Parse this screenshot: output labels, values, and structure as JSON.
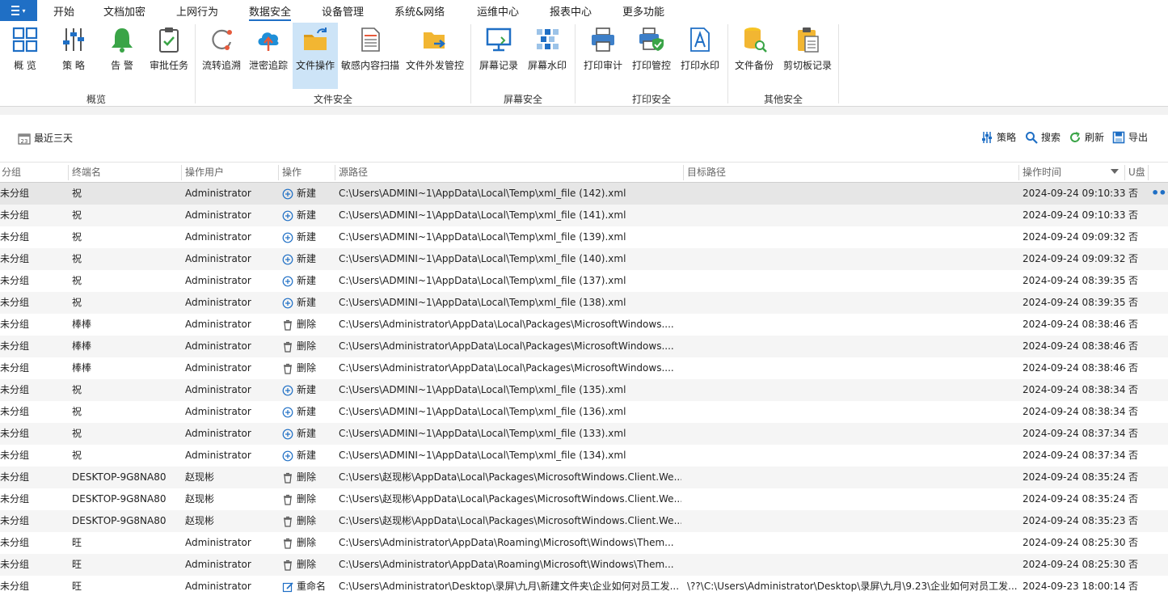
{
  "menu": {
    "items": [
      "开始",
      "文档加密",
      "上网行为",
      "数据安全",
      "设备管理",
      "系统&网络",
      "运维中心",
      "报表中心",
      "更多功能"
    ],
    "active": "数据安全"
  },
  "ribbon": {
    "buttons": [
      {
        "label": "概 览",
        "icon": "grid-icon"
      },
      {
        "label": "策 略",
        "icon": "sliders-icon"
      },
      {
        "label": "告 警",
        "icon": "bell-icon"
      },
      {
        "label": "审批任务",
        "icon": "clipboard-check-icon"
      },
      {
        "label": "流转追溯",
        "icon": "trace-icon"
      },
      {
        "label": "泄密追踪",
        "icon": "cloud-upload-icon"
      },
      {
        "label": "文件操作",
        "icon": "folder-arrow-icon",
        "active": true
      },
      {
        "label": "敏感内容扫描",
        "icon": "document-scan-icon"
      },
      {
        "label": "文件外发管控",
        "icon": "folder-send-icon"
      },
      {
        "label": "屏幕记录",
        "icon": "monitor-icon"
      },
      {
        "label": "屏幕水印",
        "icon": "watermark-icon"
      },
      {
        "label": "打印审计",
        "icon": "printer-icon"
      },
      {
        "label": "打印管控",
        "icon": "printer-shield-icon"
      },
      {
        "label": "打印水印",
        "icon": "document-a-icon"
      },
      {
        "label": "文件备份",
        "icon": "database-search-icon"
      },
      {
        "label": "剪切板记录",
        "icon": "clipboard-icon"
      }
    ],
    "groups": [
      "概览",
      "文件安全",
      "屏幕安全",
      "打印安全",
      "其他安全"
    ]
  },
  "toolbar": {
    "date_filter": "最近三天",
    "policy": "策略",
    "search": "搜索",
    "refresh": "刷新",
    "export": "导出"
  },
  "table": {
    "columns": [
      "分组",
      "终端名",
      "操作用户",
      "操作",
      "源路径",
      "目标路径",
      "操作时间",
      "U盘"
    ],
    "rows": [
      [
        "未分组",
        "祝",
        "Administrator",
        "新建",
        "C:\\Users\\ADMINI~1\\AppData\\Local\\Temp\\xml_file (142).xml",
        "",
        "2024-09-24 09:10:33",
        "否"
      ],
      [
        "未分组",
        "祝",
        "Administrator",
        "新建",
        "C:\\Users\\ADMINI~1\\AppData\\Local\\Temp\\xml_file (141).xml",
        "",
        "2024-09-24 09:10:33",
        "否"
      ],
      [
        "未分组",
        "祝",
        "Administrator",
        "新建",
        "C:\\Users\\ADMINI~1\\AppData\\Local\\Temp\\xml_file (139).xml",
        "",
        "2024-09-24 09:09:32",
        "否"
      ],
      [
        "未分组",
        "祝",
        "Administrator",
        "新建",
        "C:\\Users\\ADMINI~1\\AppData\\Local\\Temp\\xml_file (140).xml",
        "",
        "2024-09-24 09:09:32",
        "否"
      ],
      [
        "未分组",
        "祝",
        "Administrator",
        "新建",
        "C:\\Users\\ADMINI~1\\AppData\\Local\\Temp\\xml_file (137).xml",
        "",
        "2024-09-24 08:39:35",
        "否"
      ],
      [
        "未分组",
        "祝",
        "Administrator",
        "新建",
        "C:\\Users\\ADMINI~1\\AppData\\Local\\Temp\\xml_file (138).xml",
        "",
        "2024-09-24 08:39:35",
        "否"
      ],
      [
        "未分组",
        "棒棒",
        "Administrator",
        "删除",
        "C:\\Users\\Administrator\\AppData\\Local\\Packages\\MicrosoftWindows....",
        "",
        "2024-09-24 08:38:46",
        "否"
      ],
      [
        "未分组",
        "棒棒",
        "Administrator",
        "删除",
        "C:\\Users\\Administrator\\AppData\\Local\\Packages\\MicrosoftWindows....",
        "",
        "2024-09-24 08:38:46",
        "否"
      ],
      [
        "未分组",
        "棒棒",
        "Administrator",
        "删除",
        "C:\\Users\\Administrator\\AppData\\Local\\Packages\\MicrosoftWindows....",
        "",
        "2024-09-24 08:38:46",
        "否"
      ],
      [
        "未分组",
        "祝",
        "Administrator",
        "新建",
        "C:\\Users\\ADMINI~1\\AppData\\Local\\Temp\\xml_file (135).xml",
        "",
        "2024-09-24 08:38:34",
        "否"
      ],
      [
        "未分组",
        "祝",
        "Administrator",
        "新建",
        "C:\\Users\\ADMINI~1\\AppData\\Local\\Temp\\xml_file (136).xml",
        "",
        "2024-09-24 08:38:34",
        "否"
      ],
      [
        "未分组",
        "祝",
        "Administrator",
        "新建",
        "C:\\Users\\ADMINI~1\\AppData\\Local\\Temp\\xml_file (133).xml",
        "",
        "2024-09-24 08:37:34",
        "否"
      ],
      [
        "未分组",
        "祝",
        "Administrator",
        "新建",
        "C:\\Users\\ADMINI~1\\AppData\\Local\\Temp\\xml_file (134).xml",
        "",
        "2024-09-24 08:37:34",
        "否"
      ],
      [
        "未分组",
        "DESKTOP-9G8NA80",
        "赵现彬",
        "删除",
        "C:\\Users\\赵现彬\\AppData\\Local\\Packages\\MicrosoftWindows.Client.We...",
        "",
        "2024-09-24 08:35:24",
        "否"
      ],
      [
        "未分组",
        "DESKTOP-9G8NA80",
        "赵现彬",
        "删除",
        "C:\\Users\\赵现彬\\AppData\\Local\\Packages\\MicrosoftWindows.Client.We...",
        "",
        "2024-09-24 08:35:24",
        "否"
      ],
      [
        "未分组",
        "DESKTOP-9G8NA80",
        "赵现彬",
        "删除",
        "C:\\Users\\赵现彬\\AppData\\Local\\Packages\\MicrosoftWindows.Client.We...",
        "",
        "2024-09-24 08:35:23",
        "否"
      ],
      [
        "未分组",
        "旺",
        "Administrator",
        "删除",
        "C:\\Users\\Administrator\\AppData\\Roaming\\Microsoft\\Windows\\Them...",
        "",
        "2024-09-24 08:25:30",
        "否"
      ],
      [
        "未分组",
        "旺",
        "Administrator",
        "删除",
        "C:\\Users\\Administrator\\AppData\\Roaming\\Microsoft\\Windows\\Them...",
        "",
        "2024-09-24 08:25:30",
        "否"
      ],
      [
        "未分组",
        "旺",
        "Administrator",
        "重命名",
        "C:\\Users\\Administrator\\Desktop\\录屏\\九月\\新建文件夹\\企业如何对员工发...",
        "\\??\\C:\\Users\\Administrator\\Desktop\\录屏\\九月\\9.23\\企业如何对员工发...",
        "2024-09-23 18:00:14",
        "否"
      ]
    ],
    "more_actions": "•••"
  },
  "colors": {
    "accent": "#1f6fc5",
    "ribbon_active": "#cde4f7",
    "row_selected": "#e6e6e6",
    "row_alt": "#f5f5f5"
  }
}
